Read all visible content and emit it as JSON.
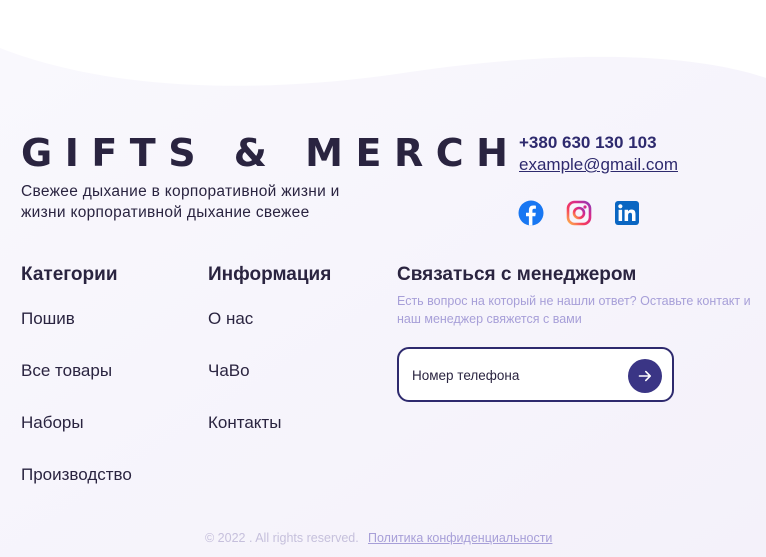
{
  "brand": {
    "logo_text": "GIFTS & MERCH",
    "tagline": "Свежее дыхание в корпоративной жизни и жизни корпоративной дыхание свежее"
  },
  "contacts": {
    "phone": "+380 630 130 103",
    "email": "example@gmail.com"
  },
  "socials": {
    "facebook_icon": "facebook-icon",
    "instagram_icon": "instagram-icon",
    "linkedin_icon": "linkedin-icon"
  },
  "categories": {
    "title": "Категории",
    "items": [
      "Пошив",
      "Все товары",
      "Наборы",
      "Производство"
    ]
  },
  "information": {
    "title": "Информация",
    "items": [
      "О нас",
      "ЧаВо",
      "Контакты"
    ]
  },
  "manager": {
    "title": "Связаться с менеджером",
    "description": "Есть вопрос на который не нашли ответ? Оставьте контакт и наш менеджер свяжется с вами",
    "phone_placeholder": "Номер телефона",
    "submit_icon": "arrow-right-icon"
  },
  "footer": {
    "copyright": "© 2022 . All rights reserved.",
    "privacy_link": "Политика конфиденциальности"
  },
  "colors": {
    "text": "#2a2440",
    "accent": "#3a3585",
    "muted": "#a79fd8",
    "background_tint": "#f8f6fc",
    "facebook": "#1877f2",
    "linkedin": "#0a66c2"
  }
}
